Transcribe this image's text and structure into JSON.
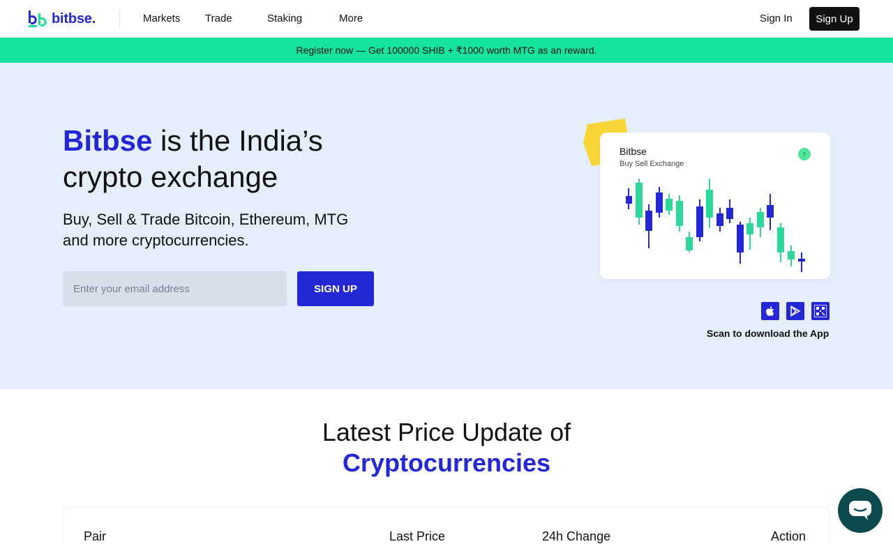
{
  "header": {
    "logo_text": "bitbse.",
    "nav": [
      {
        "label": "Markets"
      },
      {
        "label": "Trade"
      },
      {
        "label": "Staking"
      },
      {
        "label": "More"
      }
    ],
    "signin_label": "Sign In",
    "signup_label": "Sign Up"
  },
  "promo": {
    "text": "Register now — Get 100000 SHIB + ₹1000 worth MTG as an reward."
  },
  "hero": {
    "title_brand": "Bitbse",
    "title_rest_line1": " is the India’s",
    "title_line2": "crypto exchange",
    "subtitle": "Buy, Sell & Trade Bitcoin, Ethereum, MTG and more cryptocurrencies.",
    "email_placeholder": "Enter your email address",
    "signup_button": "SIGN UP"
  },
  "card": {
    "title": "Bitbse",
    "subtitle": "Buy Sell Exchange",
    "up_icon": "arrow-up-icon"
  },
  "app": {
    "icons": [
      "apple-icon",
      "play-store-icon",
      "qr-code-icon"
    ],
    "scan_text": "Scan to download the App"
  },
  "prices": {
    "title_line1": "Latest Price Update of",
    "title_line2": "Cryptocurrencies",
    "columns": [
      "Pair",
      "Last Price",
      "24h Change",
      "Action"
    ]
  },
  "colors": {
    "brand": "#2327d6",
    "accent": "#17e3a0",
    "hero_bg": "#e5effb",
    "candle_up": "#2ed89a",
    "candle_down": "#2327d6"
  }
}
